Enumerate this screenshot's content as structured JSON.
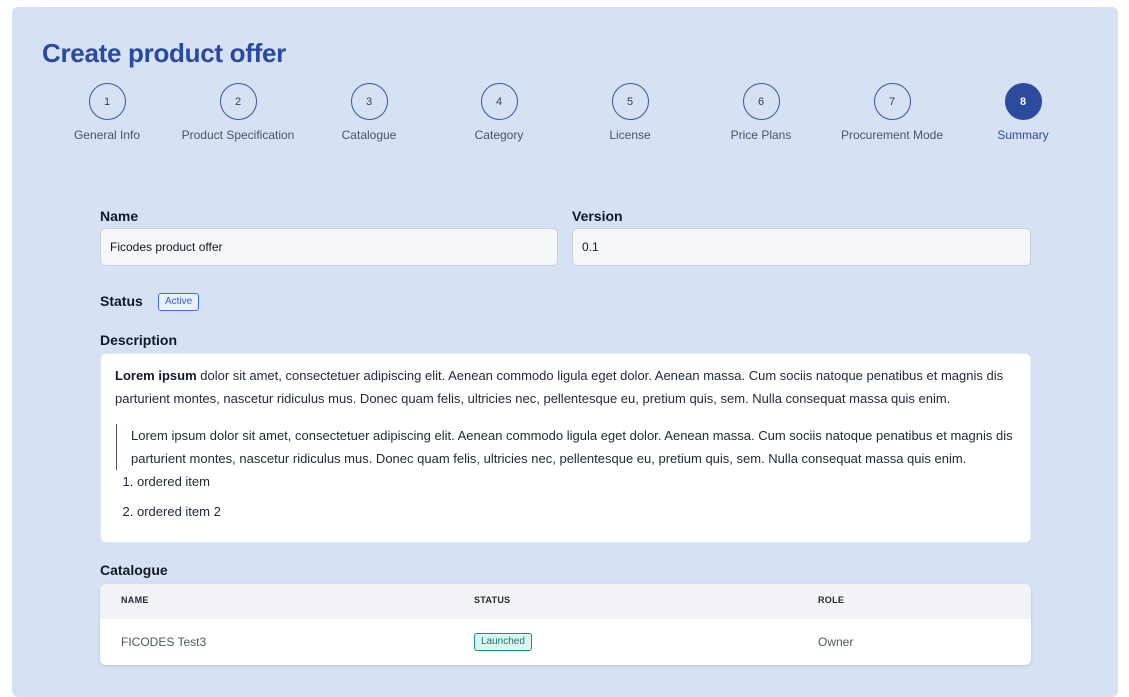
{
  "page": {
    "title": "Create product offer"
  },
  "stepper": {
    "steps": [
      {
        "number": "1",
        "label": "General Info"
      },
      {
        "number": "2",
        "label": "Product Specification"
      },
      {
        "number": "3",
        "label": "Catalogue"
      },
      {
        "number": "4",
        "label": "Category"
      },
      {
        "number": "5",
        "label": "License"
      },
      {
        "number": "6",
        "label": "Price Plans"
      },
      {
        "number": "7",
        "label": "Procurement Mode"
      },
      {
        "number": "8",
        "label": "Summary"
      }
    ],
    "active_step": "8"
  },
  "form": {
    "name_label": "Name",
    "name_value": "Ficodes product offer",
    "version_label": "Version",
    "version_value": "0.1",
    "status_label": "Status",
    "status_value": "Active",
    "description_label": "Description"
  },
  "description": {
    "lead_bold": "Lorem ipsum",
    "lead_rest": " dolor sit amet, consectetuer adipiscing elit. Aenean commodo ligula eget dolor. Aenean massa. Cum sociis natoque penatibus et magnis dis parturient montes, nascetur ridiculus mus. Donec quam felis, ultricies nec, pellentesque eu, pretium quis, sem. Nulla consequat massa quis enim.",
    "quote": "Lorem ipsum dolor sit amet, consectetuer adipiscing elit. Aenean commodo ligula eget dolor. Aenean massa. Cum sociis natoque penatibus et magnis dis parturient montes, nascetur ridiculus mus. Donec quam felis, ultricies nec, pellentesque eu, pretium quis, sem. Nulla consequat massa quis enim.",
    "list_items": [
      "ordered item",
      "ordered item 2"
    ]
  },
  "catalogue": {
    "section_label": "Catalogue",
    "columns": [
      "NAME",
      "STATUS",
      "ROLE"
    ],
    "rows": [
      {
        "name": "FICODES Test3",
        "status": "Launched",
        "role": "Owner"
      }
    ]
  },
  "colors": {
    "panel_bg": "#d7e1f4",
    "accent": "#2c4a9e",
    "status_active": "#2f5fd0",
    "status_launched": "#157a72"
  }
}
